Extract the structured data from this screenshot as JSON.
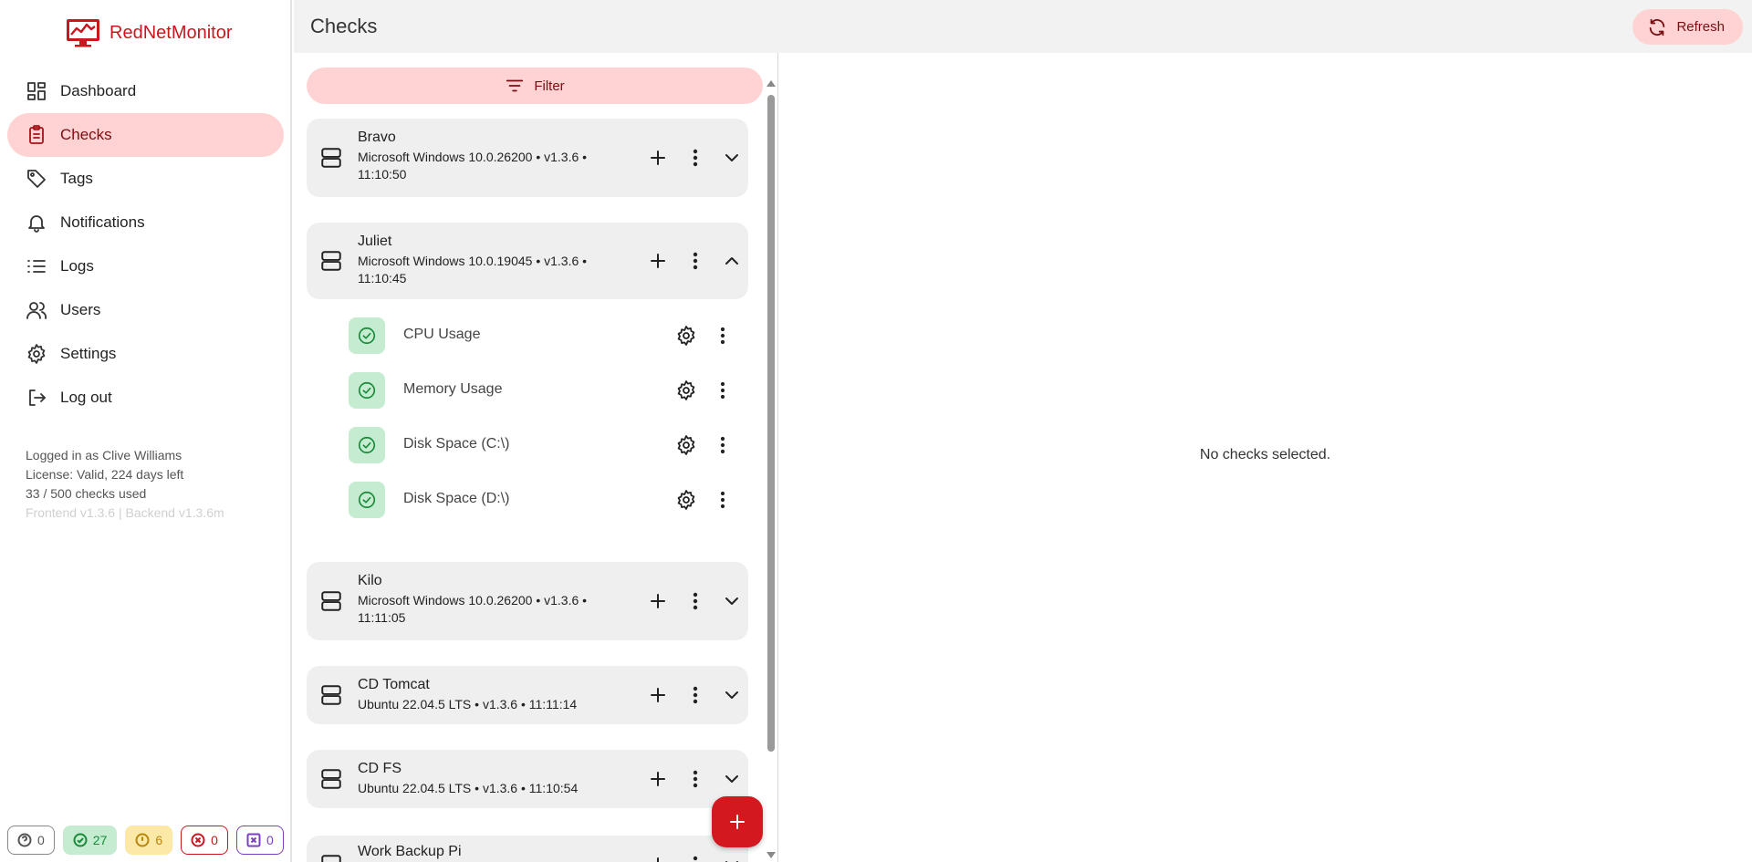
{
  "app": {
    "name": "RedNetMonitor",
    "accent": "#c8171e"
  },
  "nav": {
    "items": [
      {
        "label": "Dashboard",
        "icon": "dashboard-icon"
      },
      {
        "label": "Checks",
        "icon": "clipboard-icon",
        "active": true
      },
      {
        "label": "Tags",
        "icon": "tag-icon"
      },
      {
        "label": "Notifications",
        "icon": "bell-icon"
      },
      {
        "label": "Logs",
        "icon": "list-icon"
      },
      {
        "label": "Users",
        "icon": "users-icon"
      },
      {
        "label": "Settings",
        "icon": "gear-icon"
      },
      {
        "label": "Log out",
        "icon": "logout-icon"
      }
    ]
  },
  "info": {
    "logged_in": "Logged in as Clive Williams",
    "license": "License: Valid, 224 days left",
    "checks_used": "33 / 500 checks used",
    "versions": "Frontend v1.3.6 | Backend v1.3.6m"
  },
  "status_counts": {
    "unknown": "0",
    "ok": "27",
    "warning": "6",
    "critical": "0",
    "error": "0"
  },
  "header": {
    "title": "Checks",
    "refresh_label": "Refresh"
  },
  "filter": {
    "label": "Filter"
  },
  "hosts": [
    {
      "name": "Bravo",
      "meta": "Microsoft Windows 10.0.26200 • v1.3.6 • 11:10:50",
      "expanded": false
    },
    {
      "name": "Juliet",
      "meta": "Microsoft Windows 10.0.19045 • v1.3.6 • 11:10:45",
      "expanded": true,
      "checks": [
        {
          "name": "CPU Usage",
          "status": "ok"
        },
        {
          "name": "Memory Usage",
          "status": "ok"
        },
        {
          "name": "Disk Space (C:\\)",
          "status": "ok"
        },
        {
          "name": "Disk Space (D:\\)",
          "status": "ok"
        }
      ]
    },
    {
      "name": "Kilo",
      "meta": "Microsoft Windows 10.0.26200 • v1.3.6 • 11:11:05",
      "expanded": false
    },
    {
      "name": "CD Tomcat",
      "meta": "Ubuntu 22.04.5 LTS • v1.3.6 • 11:11:14",
      "expanded": false
    },
    {
      "name": "CD FS",
      "meta": "Ubuntu 22.04.5 LTS • v1.3.6 • 11:10:54",
      "expanded": false
    },
    {
      "name": "Work Backup Pi",
      "meta": "",
      "expanded": false
    }
  ],
  "detail": {
    "empty_text": "No checks selected."
  }
}
